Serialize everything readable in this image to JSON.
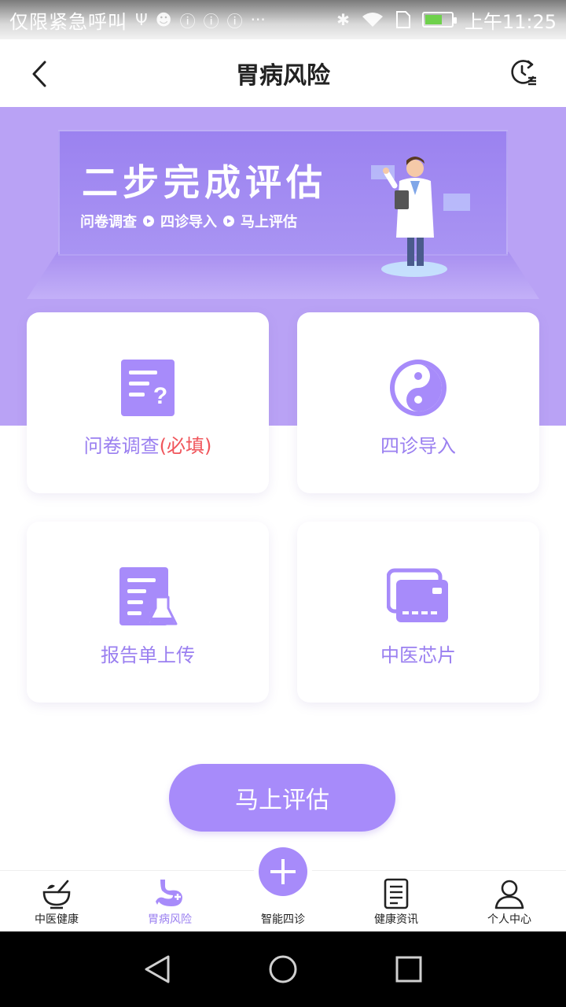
{
  "status_bar": {
    "carrier": "仅限紧急呼叫",
    "time": "上午11:25",
    "icons": [
      "usb-icon",
      "android-icon",
      "info-icon",
      "info-icon",
      "info-icon",
      "more-icon",
      "bluetooth-icon",
      "wifi-icon",
      "sim-icon",
      "battery-icon"
    ]
  },
  "header": {
    "title": "胃病风险",
    "back_icon": "chevron-left-icon",
    "history_icon": "history-icon"
  },
  "banner": {
    "title": "二步完成评估",
    "steps": [
      "问卷调查",
      "四诊导入",
      "马上评估"
    ]
  },
  "cards": {
    "questionnaire": {
      "label": "问卷调查",
      "required": "(必填)",
      "icon": "questionnaire-icon"
    },
    "diagnosis": {
      "label": "四诊导入",
      "icon": "yin-yang-icon"
    },
    "report": {
      "label": "报告单上传",
      "icon": "lab-report-icon"
    },
    "chip": {
      "label": "中医芯片",
      "icon": "card-chip-icon"
    }
  },
  "assess_button": {
    "label": "马上评估"
  },
  "bottom_nav": {
    "items": [
      {
        "label": "中医健康",
        "icon": "mortar-icon",
        "active": false
      },
      {
        "label": "胃病风险",
        "icon": "stomach-icon",
        "active": true
      },
      {
        "label": "智能四诊",
        "icon": "plus-icon",
        "active": false
      },
      {
        "label": "健康资讯",
        "icon": "document-icon",
        "active": false
      },
      {
        "label": "个人中心",
        "icon": "person-icon",
        "active": false
      }
    ]
  },
  "colors": {
    "accent": "#a78bfa",
    "banner": "#b9a2f5",
    "required": "#f0555b"
  }
}
